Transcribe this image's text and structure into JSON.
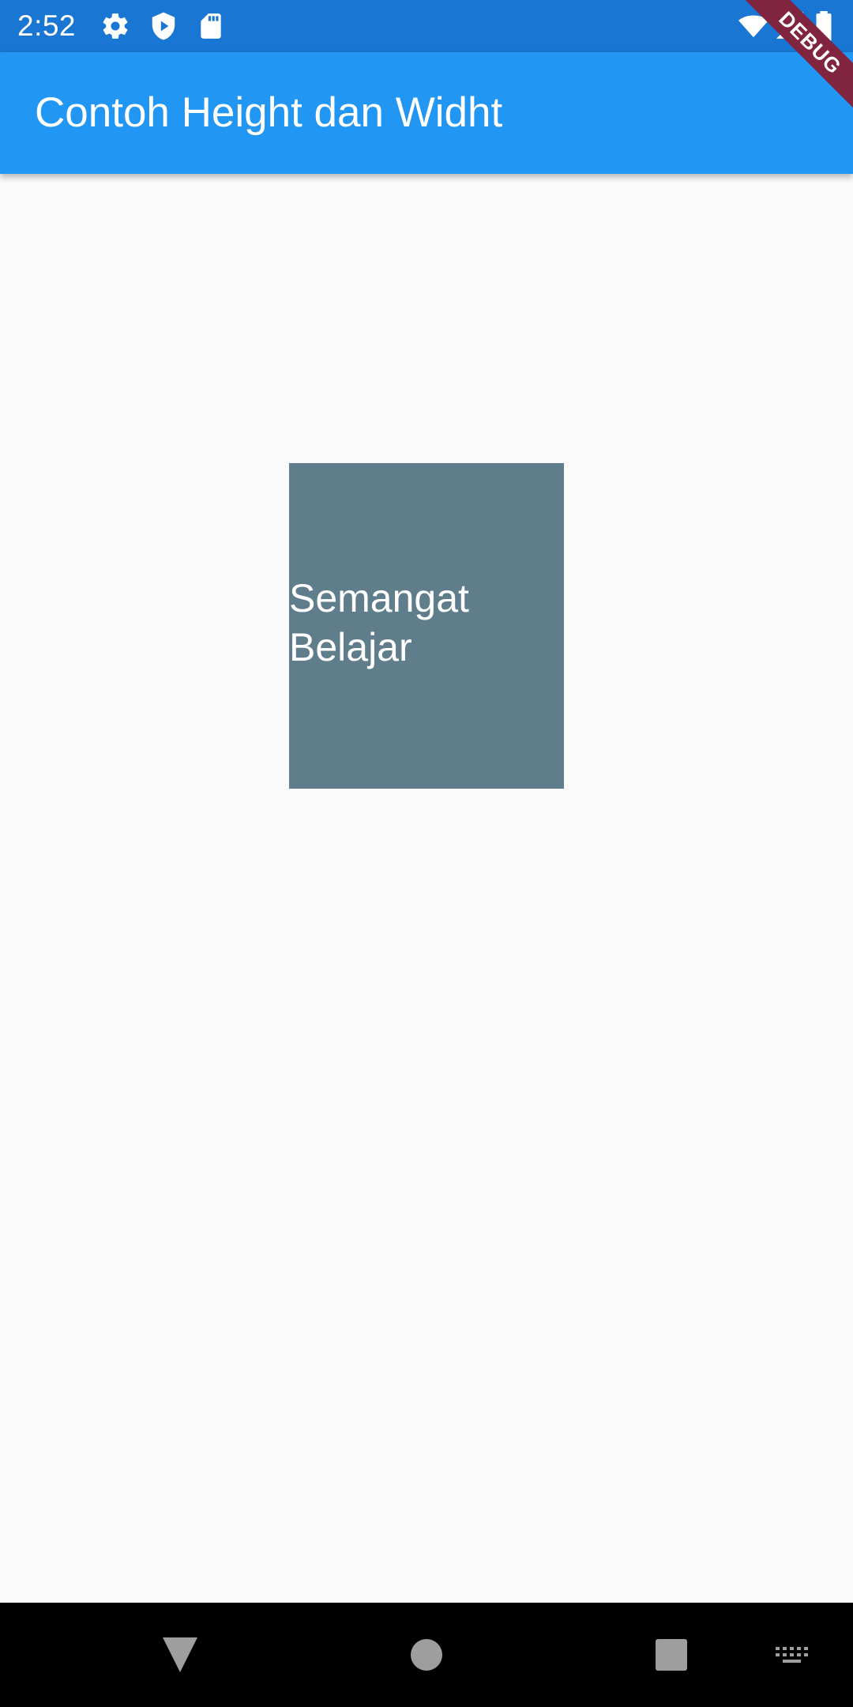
{
  "status_bar": {
    "time": "2:52",
    "icons": [
      "gear-icon",
      "shield-play-icon",
      "sd-card-icon",
      "wifi-icon",
      "signal-icon",
      "battery-icon"
    ],
    "color": "#1976D2"
  },
  "app_bar": {
    "title": "Contoh Height dan Widht",
    "color": "#2196F3"
  },
  "box": {
    "text": "Semangat Belajar",
    "color": "#607D8B"
  },
  "debug_banner": {
    "label": "DEBUG",
    "color": "#80243F"
  },
  "nav_bar": {
    "buttons": [
      "back-triangle-icon",
      "home-circle-icon",
      "recents-square-icon",
      "keyboard-icon"
    ]
  }
}
